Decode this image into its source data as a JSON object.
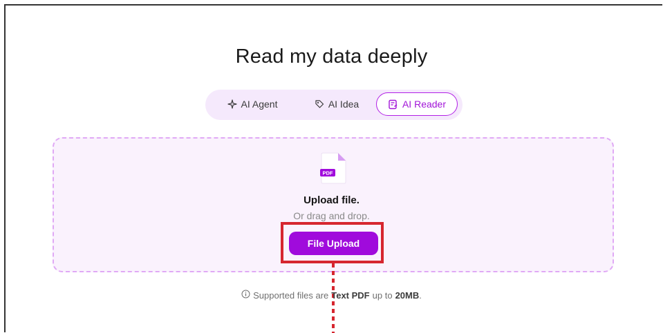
{
  "page": {
    "title": "Read my data deeply"
  },
  "tabs": [
    {
      "label": "AI Agent",
      "icon": "sparkle-icon",
      "active": false
    },
    {
      "label": "AI Idea",
      "icon": "lightbulb-tag-icon",
      "active": false
    },
    {
      "label": "AI Reader",
      "icon": "reader-doc-icon",
      "active": true
    }
  ],
  "upload": {
    "file_badge": "PDF",
    "title": "Upload file.",
    "subtitle": "Or drag and drop.",
    "button_label": "File Upload"
  },
  "footnote": {
    "prefix": "Supported files are",
    "file_type": "Text PDF",
    "middle": "up to",
    "limit": "20MB",
    "suffix": "."
  },
  "colors": {
    "accent": "#a00bdc",
    "tab_bar_bg": "#f5e9fc",
    "dropzone_bg": "#faf2fd",
    "dropzone_border": "#e0a9f5",
    "highlight": "#d6262f"
  }
}
